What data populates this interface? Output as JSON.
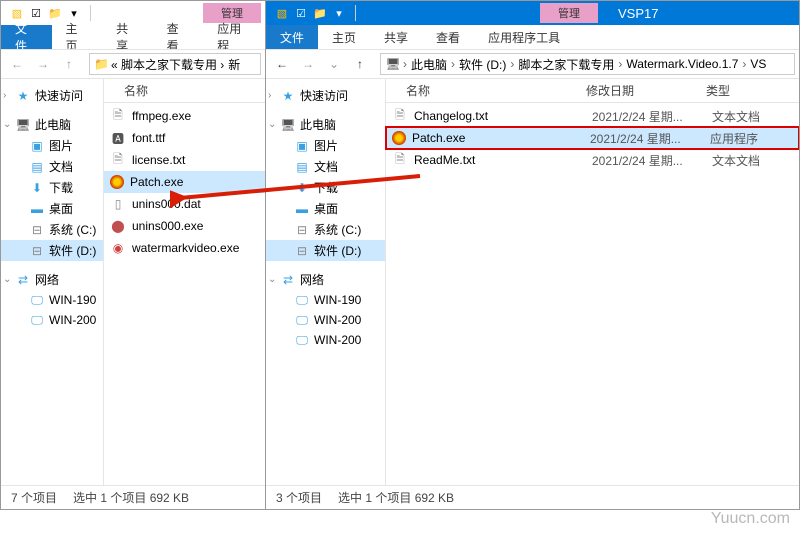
{
  "window_back": {
    "qat": {
      "manage": "管理"
    },
    "tabs": {
      "file": "文件",
      "home": "主页",
      "share": "共享",
      "view": "查看",
      "apptools": "应用程"
    },
    "breadcrumb": {
      "prefix": "« 脚本之家下载专用 ›",
      "last": "新"
    },
    "col_name": "名称",
    "files": [
      {
        "icon": "txt",
        "name": "ffmpeg.exe"
      },
      {
        "icon": "ttf",
        "name": "font.ttf"
      },
      {
        "icon": "txt",
        "name": "license.txt"
      },
      {
        "icon": "exe",
        "name": "Patch.exe",
        "selected": true
      },
      {
        "icon": "dat",
        "name": "unins000.dat"
      },
      {
        "icon": "exe2",
        "name": "unins000.exe"
      },
      {
        "icon": "exe3",
        "name": "watermarkvideo.exe"
      }
    ],
    "status": {
      "count": "7 个项目",
      "selection": "选中 1 个项目  692 KB"
    }
  },
  "window_front": {
    "contextual": "管理",
    "title": "VSP17",
    "tabs": {
      "file": "文件",
      "home": "主页",
      "share": "共享",
      "view": "查看",
      "apptools": "应用程序工具"
    },
    "breadcrumb": [
      "此电脑",
      "软件 (D:)",
      "脚本之家下载专用",
      "Watermark.Video.1.7",
      "VS"
    ],
    "cols": {
      "name": "名称",
      "date": "修改日期",
      "type": "类型"
    },
    "files": [
      {
        "icon": "txt",
        "name": "Changelog.txt",
        "date": "2021/2/24 星期...",
        "type": "文本文档"
      },
      {
        "icon": "exe",
        "name": "Patch.exe",
        "date": "2021/2/24 星期...",
        "type": "应用程序",
        "selected": true,
        "highlighted": true
      },
      {
        "icon": "txt",
        "name": "ReadMe.txt",
        "date": "2021/2/24 星期...",
        "type": "文本文档"
      }
    ],
    "status": {
      "count": "3 个项目",
      "selection": "选中 1 个项目  692 KB"
    }
  },
  "nav": {
    "quick": "快速访问",
    "pc": "此电脑",
    "pictures": "图片",
    "documents": "文档",
    "downloads": "下载",
    "desktop": "桌面",
    "sysdrive": "系统 (C:)",
    "softdrive": "软件 (D:)",
    "network": "网络",
    "win190": "WIN-190",
    "win200a": "WIN-200",
    "win200b": "WIN-200"
  },
  "watermark": "Yuucn.com"
}
